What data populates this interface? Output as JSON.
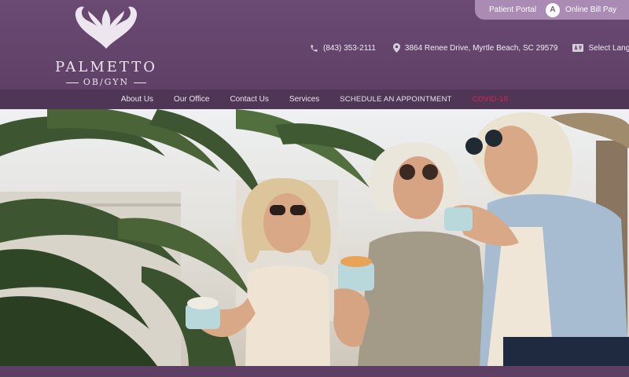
{
  "brand": {
    "name": "PALMETTO",
    "sub": "OB/GYN"
  },
  "portal": {
    "patient_portal": "Patient Portal",
    "circle_letter": "A",
    "bill_pay": "Online Bill Pay"
  },
  "contact": {
    "phone": "(843) 353-2111",
    "address": "3864 Renee Drive, Myrtle Beach, SC 29579",
    "language": "Select Language"
  },
  "nav": [
    {
      "label": "About Us"
    },
    {
      "label": "Our Office"
    },
    {
      "label": "Contact Us"
    },
    {
      "label": "Services"
    },
    {
      "label": "SCHEDULE AN APPOINTMENT"
    },
    {
      "label": "COVID-19"
    }
  ],
  "colors": {
    "header": "#6a4a72",
    "nav": "#4f3556",
    "pill": "#a98bb4",
    "alert": "#e0244a"
  },
  "icons": {
    "phone": "phone-icon",
    "location": "location-pin-icon",
    "translate": "translate-icon"
  }
}
